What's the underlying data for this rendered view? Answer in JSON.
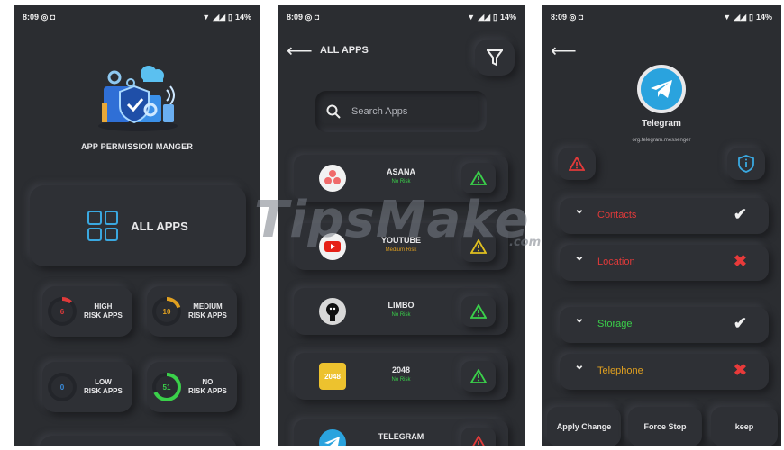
{
  "status_bar": {
    "time": "8:09",
    "battery": "14%"
  },
  "screen1": {
    "title": "APP PERMISSION MANGER",
    "all_apps_label": "ALL APPS",
    "risk_cards": [
      {
        "count": "6",
        "line1": "HIGH",
        "line2": "RISK APPS",
        "color": "#e03a3a",
        "fraction": 0.12
      },
      {
        "count": "10",
        "line1": "MEDIUM",
        "line2": "RISK APPS",
        "color": "#e0a020",
        "fraction": 0.2
      },
      {
        "count": "0",
        "line1": "LOW",
        "line2": "RISK APPS",
        "color": "#3a8fe0",
        "fraction": 0
      },
      {
        "count": "51",
        "line1": "NO",
        "line2": "RISK APPS",
        "color": "#3ad04a",
        "fraction": 0.68
      }
    ]
  },
  "screen2": {
    "header": "ALL APPS",
    "search_placeholder": "Search Apps",
    "apps": [
      {
        "name": "ASANA",
        "risk": "No Risk",
        "risk_color": "#3ad04a",
        "warn_color": "#3ad04a",
        "icon": "asana-icon"
      },
      {
        "name": "YOUTUBE",
        "risk": "Medium Risk",
        "risk_color": "#e0a020",
        "warn_color": "#e0c020",
        "icon": "youtube-icon"
      },
      {
        "name": "LIMBO",
        "risk": "No Risk",
        "risk_color": "#3ad04a",
        "warn_color": "#3ad04a",
        "icon": "limbo-icon"
      },
      {
        "name": "2048",
        "risk": "No Risk",
        "risk_color": "#3ad04a",
        "warn_color": "#3ad04a",
        "icon": "game-2048-icon",
        "icon_text": "2048"
      },
      {
        "name": "TELEGRAM",
        "risk": "",
        "risk_color": "#e03a3a",
        "warn_color": "#e03a3a",
        "icon": "telegram-icon"
      }
    ]
  },
  "screen3": {
    "app_name": "Telegram",
    "package": "org.telegram.messenger",
    "permissions": [
      {
        "label": "Contacts",
        "color": "#e03a3a",
        "granted": true,
        "mark": "✔",
        "mark_color": "#f0f0f0"
      },
      {
        "label": "Location",
        "color": "#e03a3a",
        "granted": false,
        "mark": "✖",
        "mark_color": "#e83a3a"
      },
      {
        "label": "Storage",
        "color": "#3ad04a",
        "granted": true,
        "mark": "✔",
        "mark_color": "#f0f0f0"
      },
      {
        "label": "Telephone",
        "color": "#e0a020",
        "granted": false,
        "mark": "✖",
        "mark_color": "#e83a3a"
      }
    ],
    "buttons": {
      "apply": "Apply Change",
      "force_stop": "Force Stop",
      "keep": "keep"
    }
  },
  "watermark": {
    "main": "TipsMake",
    "suffix": ".com"
  }
}
